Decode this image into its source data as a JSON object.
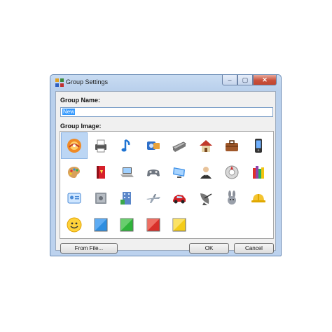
{
  "window": {
    "title": "Group Settings"
  },
  "caption": {
    "minimize": "–",
    "maximize": "▢",
    "close": "✕"
  },
  "form": {
    "group_name_label": "Group Name:",
    "group_name_value": "New",
    "group_image_label": "Group Image:"
  },
  "icons": [
    "music-cd-icon",
    "printer-icon",
    "music-note-icon",
    "media-player-icon",
    "scanner-icon",
    "home-icon",
    "briefcase-icon",
    "mobile-phone-icon",
    "paint-palette-icon",
    "book-icon",
    "laptop-icon",
    "gamepad-icon",
    "monitor-icon",
    "contact-person-icon",
    "disc-drive-icon",
    "books-icon",
    "id-card-icon",
    "safe-icon",
    "building-icon",
    "airplane-icon",
    "car-icon",
    "satellite-dish-icon",
    "rabbit-icon",
    "hard-hat-icon",
    "smiley-icon",
    "blue-swatch-icon",
    "green-swatch-icon",
    "red-swatch-icon",
    "yellow-swatch-icon"
  ],
  "selected_index": 0,
  "buttons": {
    "from_file": "From File...",
    "ok": "OK",
    "cancel": "Cancel"
  }
}
